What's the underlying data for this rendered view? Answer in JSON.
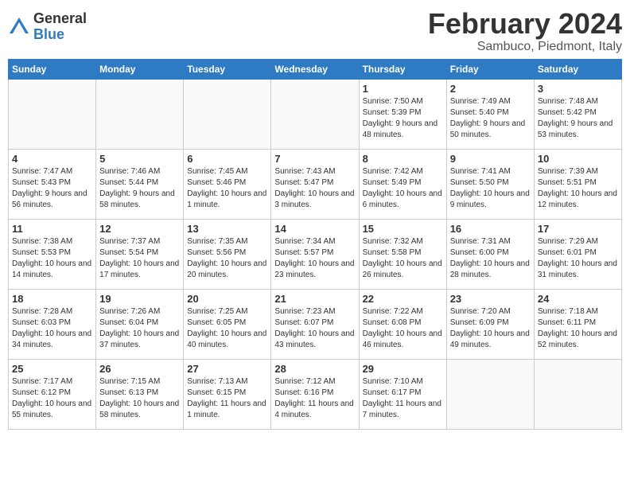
{
  "logo": {
    "general": "General",
    "blue": "Blue"
  },
  "title": "February 2024",
  "location": "Sambuco, Piedmont, Italy",
  "days_of_week": [
    "Sunday",
    "Monday",
    "Tuesday",
    "Wednesday",
    "Thursday",
    "Friday",
    "Saturday"
  ],
  "weeks": [
    [
      {
        "day": "",
        "info": ""
      },
      {
        "day": "",
        "info": ""
      },
      {
        "day": "",
        "info": ""
      },
      {
        "day": "",
        "info": ""
      },
      {
        "day": "1",
        "info": "Sunrise: 7:50 AM\nSunset: 5:39 PM\nDaylight: 9 hours and 48 minutes."
      },
      {
        "day": "2",
        "info": "Sunrise: 7:49 AM\nSunset: 5:40 PM\nDaylight: 9 hours and 50 minutes."
      },
      {
        "day": "3",
        "info": "Sunrise: 7:48 AM\nSunset: 5:42 PM\nDaylight: 9 hours and 53 minutes."
      }
    ],
    [
      {
        "day": "4",
        "info": "Sunrise: 7:47 AM\nSunset: 5:43 PM\nDaylight: 9 hours and 56 minutes."
      },
      {
        "day": "5",
        "info": "Sunrise: 7:46 AM\nSunset: 5:44 PM\nDaylight: 9 hours and 58 minutes."
      },
      {
        "day": "6",
        "info": "Sunrise: 7:45 AM\nSunset: 5:46 PM\nDaylight: 10 hours and 1 minute."
      },
      {
        "day": "7",
        "info": "Sunrise: 7:43 AM\nSunset: 5:47 PM\nDaylight: 10 hours and 3 minutes."
      },
      {
        "day": "8",
        "info": "Sunrise: 7:42 AM\nSunset: 5:49 PM\nDaylight: 10 hours and 6 minutes."
      },
      {
        "day": "9",
        "info": "Sunrise: 7:41 AM\nSunset: 5:50 PM\nDaylight: 10 hours and 9 minutes."
      },
      {
        "day": "10",
        "info": "Sunrise: 7:39 AM\nSunset: 5:51 PM\nDaylight: 10 hours and 12 minutes."
      }
    ],
    [
      {
        "day": "11",
        "info": "Sunrise: 7:38 AM\nSunset: 5:53 PM\nDaylight: 10 hours and 14 minutes."
      },
      {
        "day": "12",
        "info": "Sunrise: 7:37 AM\nSunset: 5:54 PM\nDaylight: 10 hours and 17 minutes."
      },
      {
        "day": "13",
        "info": "Sunrise: 7:35 AM\nSunset: 5:56 PM\nDaylight: 10 hours and 20 minutes."
      },
      {
        "day": "14",
        "info": "Sunrise: 7:34 AM\nSunset: 5:57 PM\nDaylight: 10 hours and 23 minutes."
      },
      {
        "day": "15",
        "info": "Sunrise: 7:32 AM\nSunset: 5:58 PM\nDaylight: 10 hours and 26 minutes."
      },
      {
        "day": "16",
        "info": "Sunrise: 7:31 AM\nSunset: 6:00 PM\nDaylight: 10 hours and 28 minutes."
      },
      {
        "day": "17",
        "info": "Sunrise: 7:29 AM\nSunset: 6:01 PM\nDaylight: 10 hours and 31 minutes."
      }
    ],
    [
      {
        "day": "18",
        "info": "Sunrise: 7:28 AM\nSunset: 6:03 PM\nDaylight: 10 hours and 34 minutes."
      },
      {
        "day": "19",
        "info": "Sunrise: 7:26 AM\nSunset: 6:04 PM\nDaylight: 10 hours and 37 minutes."
      },
      {
        "day": "20",
        "info": "Sunrise: 7:25 AM\nSunset: 6:05 PM\nDaylight: 10 hours and 40 minutes."
      },
      {
        "day": "21",
        "info": "Sunrise: 7:23 AM\nSunset: 6:07 PM\nDaylight: 10 hours and 43 minutes."
      },
      {
        "day": "22",
        "info": "Sunrise: 7:22 AM\nSunset: 6:08 PM\nDaylight: 10 hours and 46 minutes."
      },
      {
        "day": "23",
        "info": "Sunrise: 7:20 AM\nSunset: 6:09 PM\nDaylight: 10 hours and 49 minutes."
      },
      {
        "day": "24",
        "info": "Sunrise: 7:18 AM\nSunset: 6:11 PM\nDaylight: 10 hours and 52 minutes."
      }
    ],
    [
      {
        "day": "25",
        "info": "Sunrise: 7:17 AM\nSunset: 6:12 PM\nDaylight: 10 hours and 55 minutes."
      },
      {
        "day": "26",
        "info": "Sunrise: 7:15 AM\nSunset: 6:13 PM\nDaylight: 10 hours and 58 minutes."
      },
      {
        "day": "27",
        "info": "Sunrise: 7:13 AM\nSunset: 6:15 PM\nDaylight: 11 hours and 1 minute."
      },
      {
        "day": "28",
        "info": "Sunrise: 7:12 AM\nSunset: 6:16 PM\nDaylight: 11 hours and 4 minutes."
      },
      {
        "day": "29",
        "info": "Sunrise: 7:10 AM\nSunset: 6:17 PM\nDaylight: 11 hours and 7 minutes."
      },
      {
        "day": "",
        "info": ""
      },
      {
        "day": "",
        "info": ""
      }
    ]
  ]
}
